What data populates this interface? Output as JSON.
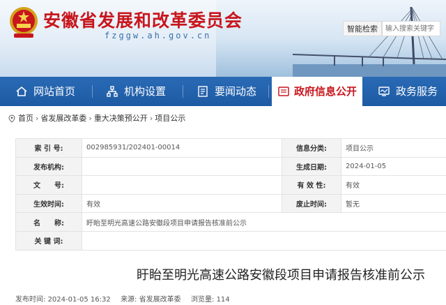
{
  "header": {
    "site_title": "安徽省发展和改革委员会",
    "domain": "fzggw.ah.gov.cn",
    "search_button": "智能检索",
    "search_placeholder": "输入搜索关键字"
  },
  "nav": {
    "items": [
      {
        "label": "网站首页",
        "icon": "home-icon"
      },
      {
        "label": "机构设置",
        "icon": "org-chart-icon"
      },
      {
        "label": "要闻动态",
        "icon": "news-icon"
      },
      {
        "label": "政府信息公开",
        "icon": "info-folder-icon",
        "active": true
      },
      {
        "label": "政务服务",
        "icon": "service-monitor-icon"
      }
    ]
  },
  "breadcrumb": {
    "items": [
      "首页",
      "省发展改革委",
      "重大决策预公开",
      "项目公示"
    ],
    "separator": "›"
  },
  "info": {
    "index_label": "索 引 号:",
    "index_value": "002985931/202401-00014",
    "category_label": "信息分类:",
    "category_value": "项目公示",
    "publisher_label": "发布机构:",
    "publisher_value": "",
    "created_label": "生成日期:",
    "created_value": "2024-01-05",
    "docno_label": "文　　号:",
    "docno_value": "",
    "validity_label": "有 效 性:",
    "validity_value": "有效",
    "effective_label": "生效时间:",
    "effective_value": "有效",
    "repeal_label": "废止时间:",
    "repeal_value": "暂无",
    "name_label": "名　　称:",
    "name_value": "盱眙至明光高速公路安徽段项目申请报告核准前公示",
    "keywords_label": "关 键 词:",
    "keywords_value": ""
  },
  "article": {
    "title": "盱眙至明光高速公路安徽段项目申请报告核准前公示",
    "published_label": "发布时间:",
    "published_value": "2024-01-05 16:32",
    "source_label": "来源:",
    "source_value": "省发展改革委",
    "views_label": "浏览量:",
    "views_value": "114"
  },
  "colors": {
    "brand_red": "#c8161d",
    "nav_blue": "#1d5aa3",
    "table_key_bg": "#f3f3f3"
  }
}
